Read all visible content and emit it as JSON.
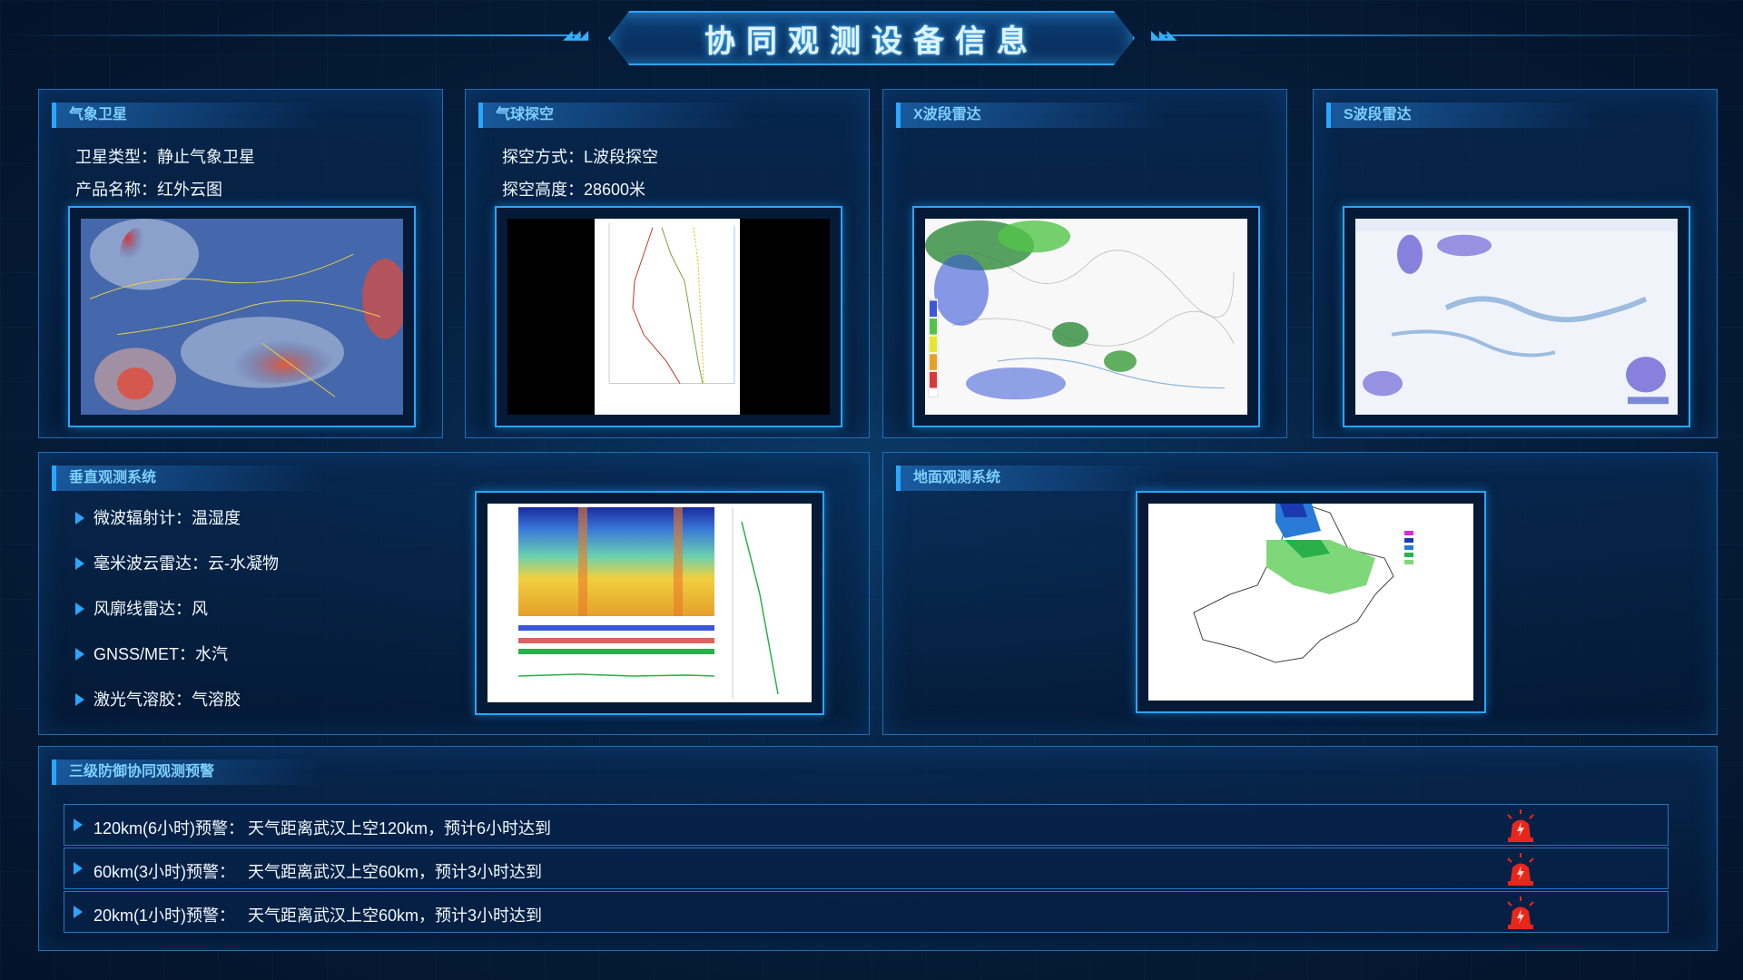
{
  "header": {
    "title": "协同观测设备信息"
  },
  "panels": {
    "satellite": {
      "title": "气象卫星",
      "lines": [
        {
          "key": "卫星类型：",
          "value": "静止气象卫星"
        },
        {
          "key": "产品名称：",
          "value": "红外云图"
        }
      ]
    },
    "balloon": {
      "title": "气球探空",
      "lines": [
        {
          "key": "探空方式：",
          "value": "L波段探空"
        },
        {
          "key": "探空高度：",
          "value": "28600米"
        }
      ]
    },
    "x_radar": {
      "title": "X波段雷达"
    },
    "s_radar": {
      "title": "S波段雷达"
    },
    "vertical": {
      "title": "垂直观测系统",
      "items": [
        "微波辐射计：温湿度",
        "毫米波云雷达：云-水凝物",
        "风廓线雷达：风",
        "GNSS/MET：水汽",
        "激光气溶胶：气溶胶"
      ]
    },
    "ground": {
      "title": "地面观测系统"
    },
    "warning": {
      "title": "三级防御协同观测预警",
      "rows": [
        {
          "label": "120km(6小时)预警：",
          "text": "天气距离武汉上空120km，预计6小时达到"
        },
        {
          "label": "60km(3小时)预警：",
          "text": "天气距离武汉上空60km，预计3小时达到"
        },
        {
          "label": "20km(1小时)预警：",
          "text": "天气距离武汉上空60km，预计3小时达到"
        }
      ]
    }
  },
  "colors": {
    "accent": "#2aa6ff",
    "panel_title": "#7cd0ff",
    "alarm": "#e8261c"
  },
  "icons": {
    "alarm": "alarm-light-icon",
    "bullet": "triangle-bullet-icon"
  }
}
